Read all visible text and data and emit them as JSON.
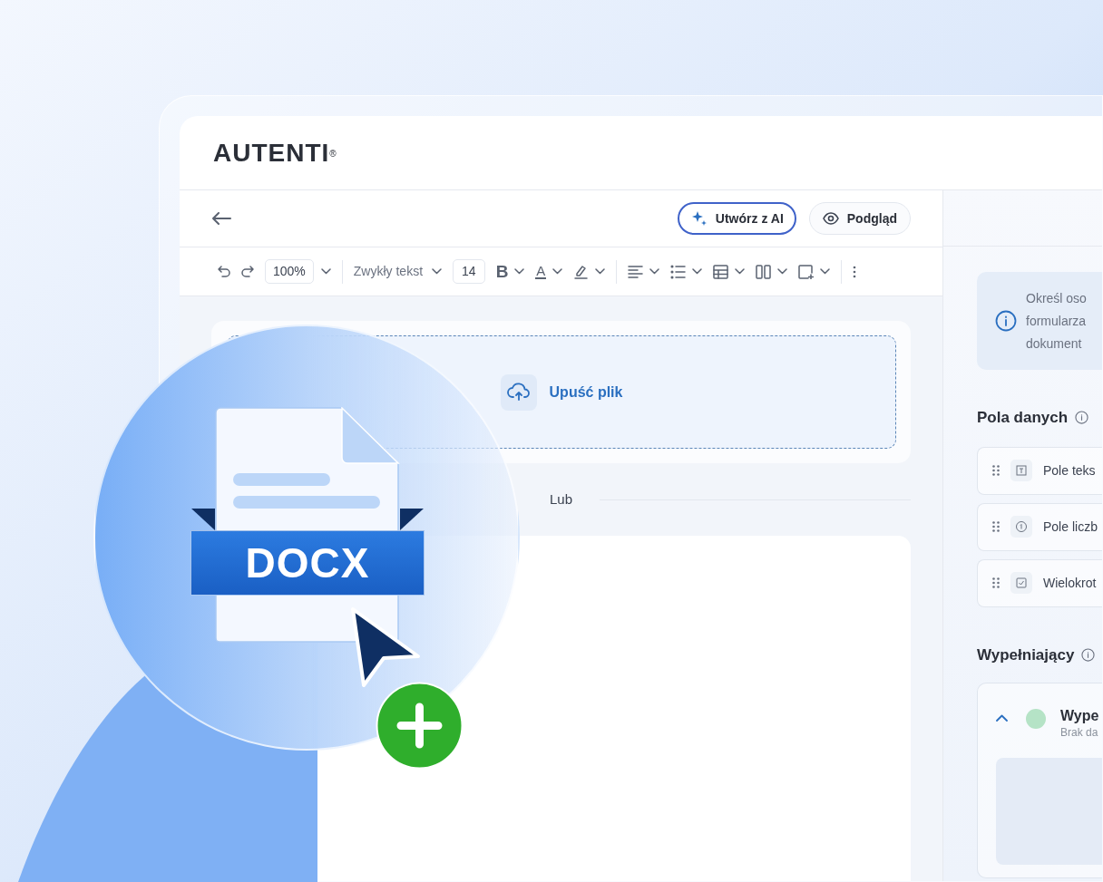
{
  "logo": {
    "text": "AUTENTI",
    "mark": "®"
  },
  "topbar": {
    "buttons": [
      {
        "label": "Utwórz z AI",
        "kind": "ai"
      },
      {
        "label": "Podgląd",
        "kind": "preview"
      }
    ]
  },
  "toolbar": {
    "zoom": "100%",
    "text_style": "Zwykły tekst",
    "font_size": "14",
    "tools": [
      {
        "kind": "bold",
        "label": "B"
      },
      {
        "kind": "text_color",
        "label": "A"
      },
      {
        "kind": "highlight"
      },
      {
        "kind": "align"
      },
      {
        "kind": "list"
      },
      {
        "kind": "table"
      },
      {
        "kind": "columns"
      },
      {
        "kind": "insert"
      }
    ]
  },
  "dropzone": {
    "label": "Upuść plik"
  },
  "divider_label": "Lub",
  "info": {
    "text": "Określ oso\nformularza\ndokument"
  },
  "data_fields": {
    "title": "Pola danych",
    "items": [
      {
        "label": "Pole teks",
        "kind": "text"
      },
      {
        "label": "Pole liczb",
        "kind": "number"
      },
      {
        "label": "Wielokrot",
        "kind": "checkbox"
      }
    ]
  },
  "fillers": {
    "title": "Wypełniający",
    "items": [
      {
        "name": "Wype",
        "subtitle": "Brak da",
        "color": "#b5e3c6",
        "expanded": true
      }
    ]
  },
  "illustration": {
    "file_label": "DOCX"
  }
}
